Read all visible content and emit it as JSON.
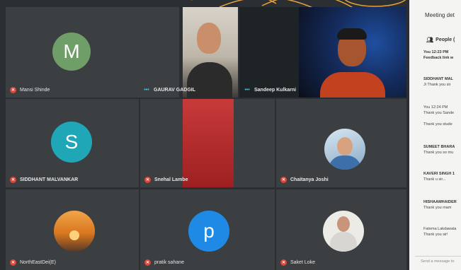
{
  "participants": [
    {
      "name": "Mansi Shinde",
      "initial": "M"
    },
    {
      "name": "GAURAV GADGIL"
    },
    {
      "name": "Sandeep Kulkarni"
    },
    {
      "name": "SIDDHANT MALVANKAR",
      "initial": "S"
    },
    {
      "name": "Snehal Lambe"
    },
    {
      "name": "Chaitanya Joshi"
    },
    {
      "name": "NorthEastDei(E)"
    },
    {
      "name": "pratik sahane",
      "initial": "p"
    },
    {
      "name": "Saket Loke"
    }
  ],
  "sidebar": {
    "title": "Meeting det",
    "people_label": "People (",
    "messages": [
      {
        "line1": "You  12:23 PM",
        "line2": "Feedback link w"
      },
      {
        "line1": "SIDDHANT MAL",
        "line2": "Ji Thank you sir"
      },
      {
        "line1": "You  12:24 PM",
        "line2": "Thank you Sande"
      },
      {
        "line1": "",
        "line2": "Thank you stude"
      },
      {
        "line1": "SUMEET BHARA",
        "line2": "Thank you so mu"
      },
      {
        "line1": "KAVERI SINGH  1",
        "line2": "Thank u sir..."
      },
      {
        "line1": "HISHAAMHAIDER",
        "line2": "Thank you mam"
      },
      {
        "line1": "Fatema Lakdawala",
        "line2": "Thank you sir!"
      }
    ],
    "input_placeholder": "Send a message to"
  },
  "colors": {
    "avatar_m": "#6f9e68",
    "avatar_s": "#1fa7b8",
    "avatar_p": "#1e8ae6",
    "mute_red": "#d9483b",
    "tile_bg": "#3a3e42"
  }
}
